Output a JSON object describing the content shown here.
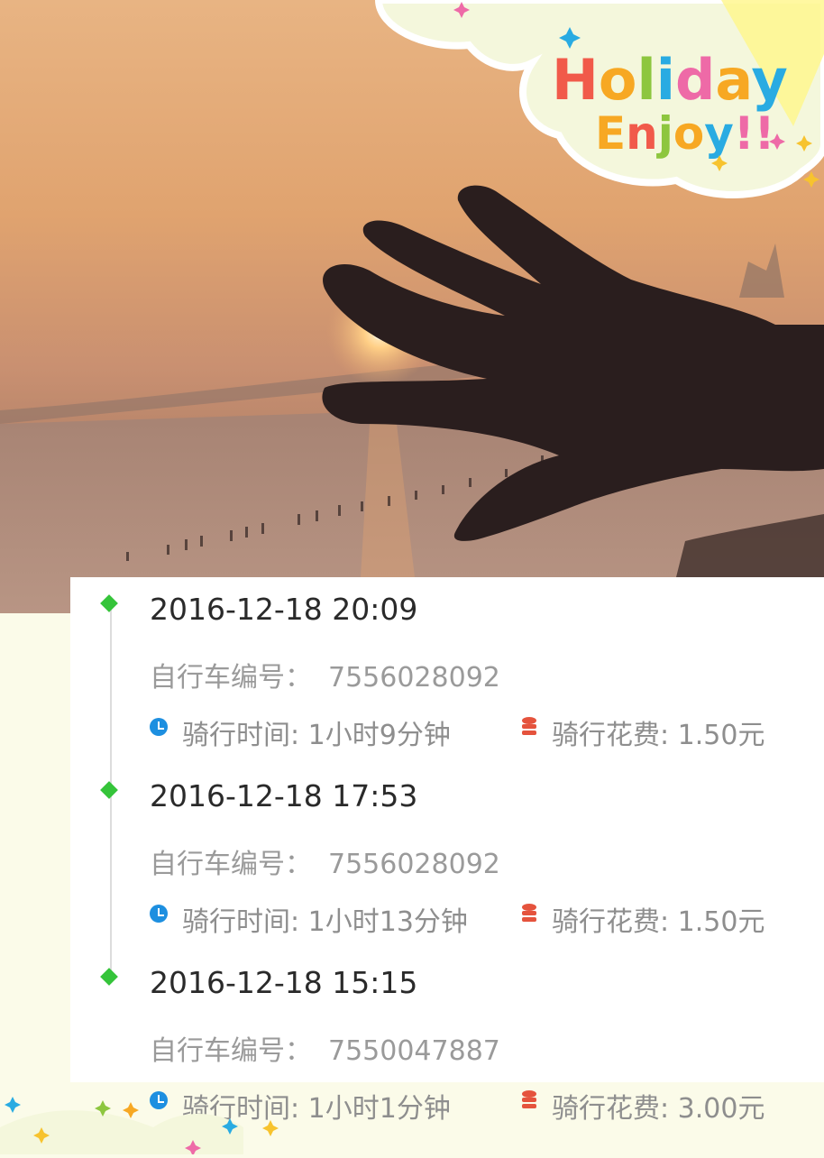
{
  "sticker": {
    "line1": "Holiday",
    "line2": "Enjoy!!"
  },
  "colors": {
    "timeline_marker": "#35c43a",
    "clock_icon": "#1d8fe0",
    "coin_icon": "#e5533d"
  },
  "trips": [
    {
      "timestamp": "2016-12-18 20:09",
      "bike_label": "自行车编号：",
      "bike_number": "7556028092",
      "time_label": "骑行时间: ",
      "duration": "1小时9分钟",
      "cost_label": "骑行花费: ",
      "cost": "1.50元"
    },
    {
      "timestamp": "2016-12-18 17:53",
      "bike_label": "自行车编号：",
      "bike_number": "7556028092",
      "time_label": "骑行时间: ",
      "duration": "1小时13分钟",
      "cost_label": "骑行花费: ",
      "cost": "1.50元"
    },
    {
      "timestamp": "2016-12-18 15:15",
      "bike_label": "自行车编号：",
      "bike_number": "7550047887",
      "time_label": "骑行时间: ",
      "duration": "1小时1分钟",
      "cost_label": "骑行花费: ",
      "cost": "3.00元"
    }
  ]
}
